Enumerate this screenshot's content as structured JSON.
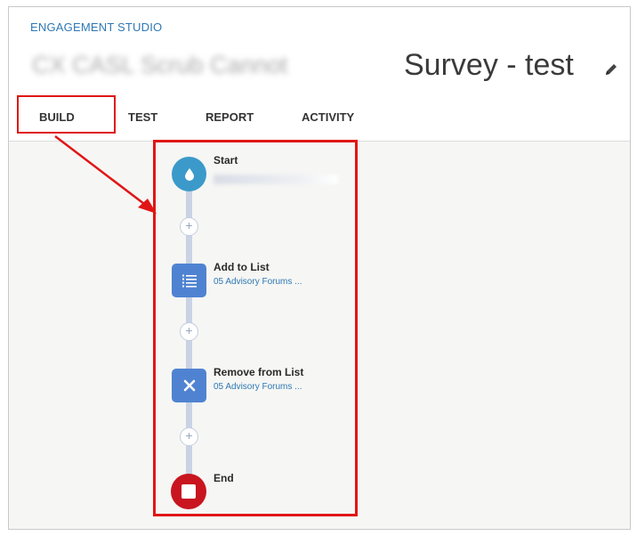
{
  "header": {
    "app_title": "ENGAGEMENT STUDIO",
    "program_name_blurred": "CX CASL Scrub Cannot",
    "page_title": "Survey - test"
  },
  "tabs": [
    {
      "label": "BUILD"
    },
    {
      "label": "TEST"
    },
    {
      "label": "REPORT"
    },
    {
      "label": "ACTIVITY"
    }
  ],
  "flow": {
    "start": {
      "label": "Start"
    },
    "add_to_list": {
      "label": "Add to List",
      "detail": "05 Advisory Forums ..."
    },
    "remove_from_list": {
      "label": "Remove from List",
      "detail": "05 Advisory Forums ..."
    },
    "end": {
      "label": "End"
    },
    "add_step_glyph": "+"
  },
  "colors": {
    "highlight": "#e01616",
    "start_node": "#3b9ac9",
    "action_node": "#4f83d1",
    "end_node": "#c8151f",
    "link_blue": "#2e78b4"
  },
  "icons": {
    "start": "water-drop-icon",
    "add_to_list": "numbered-list-icon",
    "remove_from_list": "x-mark-icon",
    "end": "stop-square-icon",
    "edit": "pencil-icon"
  }
}
